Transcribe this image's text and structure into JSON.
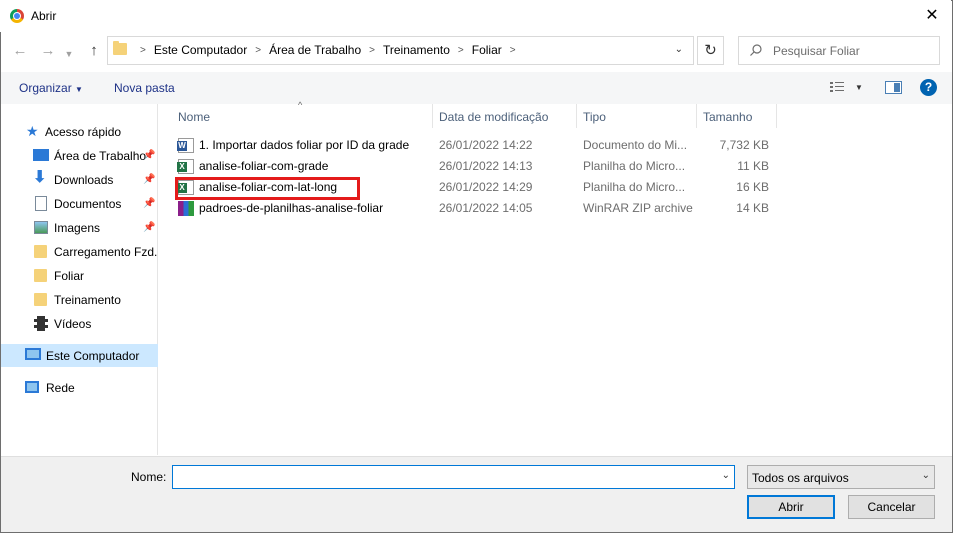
{
  "window": {
    "title": "Abrir",
    "close_glyph": "✕"
  },
  "address": {
    "crumbs": [
      "Este Computador",
      "Área de Trabalho",
      "Treinamento",
      "Foliar"
    ]
  },
  "search": {
    "placeholder": "Pesquisar Foliar"
  },
  "toolbar": {
    "organize": "Organizar",
    "new_folder": "Nova pasta"
  },
  "sidebar": {
    "quick_access": "Acesso rápido",
    "items": [
      {
        "label": "Área de Trabalho",
        "icon": "desktop-icon",
        "pinned": true
      },
      {
        "label": "Downloads",
        "icon": "download-arrow-icon",
        "pinned": true
      },
      {
        "label": "Documentos",
        "icon": "document-icon",
        "pinned": true
      },
      {
        "label": "Imagens",
        "icon": "image-icon",
        "pinned": true
      },
      {
        "label": "Carregamento Fzd.",
        "icon": "folder-icon",
        "pinned": false
      },
      {
        "label": "Foliar",
        "icon": "folder-icon",
        "pinned": false
      },
      {
        "label": "Treinamento",
        "icon": "folder-icon",
        "pinned": false
      },
      {
        "label": "Vídeos",
        "icon": "video-icon",
        "pinned": false
      }
    ],
    "this_pc": "Este Computador",
    "network": "Rede"
  },
  "columns": {
    "name": "Nome",
    "date": "Data de modificação",
    "type": "Tipo",
    "size": "Tamanho"
  },
  "files": [
    {
      "name": "1. Importar dados foliar por ID da grade",
      "date": "26/01/2022 14:22",
      "type": "Documento do Mi...",
      "size": "7,732 KB",
      "icon": "word-icon"
    },
    {
      "name": "analise-foliar-com-grade",
      "date": "26/01/2022 14:13",
      "type": "Planilha do Micro...",
      "size": "11 KB",
      "icon": "excel-icon"
    },
    {
      "name": "analise-foliar-com-lat-long",
      "date": "26/01/2022 14:29",
      "type": "Planilha do Micro...",
      "size": "16 KB",
      "icon": "excel-icon"
    },
    {
      "name": "padroes-de-planilhas-analise-foliar",
      "date": "26/01/2022 14:05",
      "type": "WinRAR ZIP archive",
      "size": "14 KB",
      "icon": "winrar-icon"
    }
  ],
  "footer": {
    "name_label": "Nome:",
    "name_value": "",
    "filetype": "Todos os arquivos",
    "open": "Abrir",
    "cancel": "Cancelar"
  },
  "colors": {
    "accent": "#0078d7",
    "highlight": "#e41b1b",
    "selected": "#cce8ff"
  }
}
